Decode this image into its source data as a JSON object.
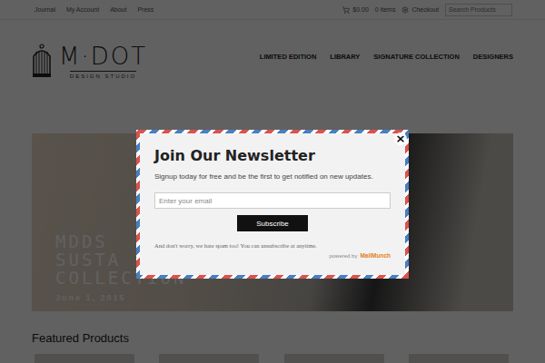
{
  "top_links": [
    "Journal",
    "My Account",
    "About",
    "Press"
  ],
  "cart": {
    "total": "$0.00",
    "items": "0 items"
  },
  "checkout": "Checkout",
  "search": {
    "placeholder": "Search Products"
  },
  "logo": {
    "name": "M·DOT",
    "tagline": "DESIGN STUDIO"
  },
  "nav": [
    {
      "label": "LIMITED EDITION",
      "selected": false
    },
    {
      "label": "LIBRARY",
      "selected": false
    },
    {
      "label": "SIGNATURE COLLECTION",
      "selected": false
    },
    {
      "label": "DESIGNERS",
      "selected": false
    }
  ],
  "hero": {
    "lines": [
      "MDDS",
      "SUSTA",
      "COLLECTION"
    ],
    "date": "June 1, 2015"
  },
  "featured": {
    "title": "Featured Products"
  },
  "modal": {
    "title": "Join Our Newsletter",
    "subtitle": "Signup today for free and be the first to get notified on new updates.",
    "email_placeholder": "Enter your email",
    "button": "Subscribe",
    "note": "And don't worry, we hate spam too! You can unsubscribe at anytime.",
    "powered_by": "powered by",
    "brand": "MailMunch",
    "close": "×"
  }
}
